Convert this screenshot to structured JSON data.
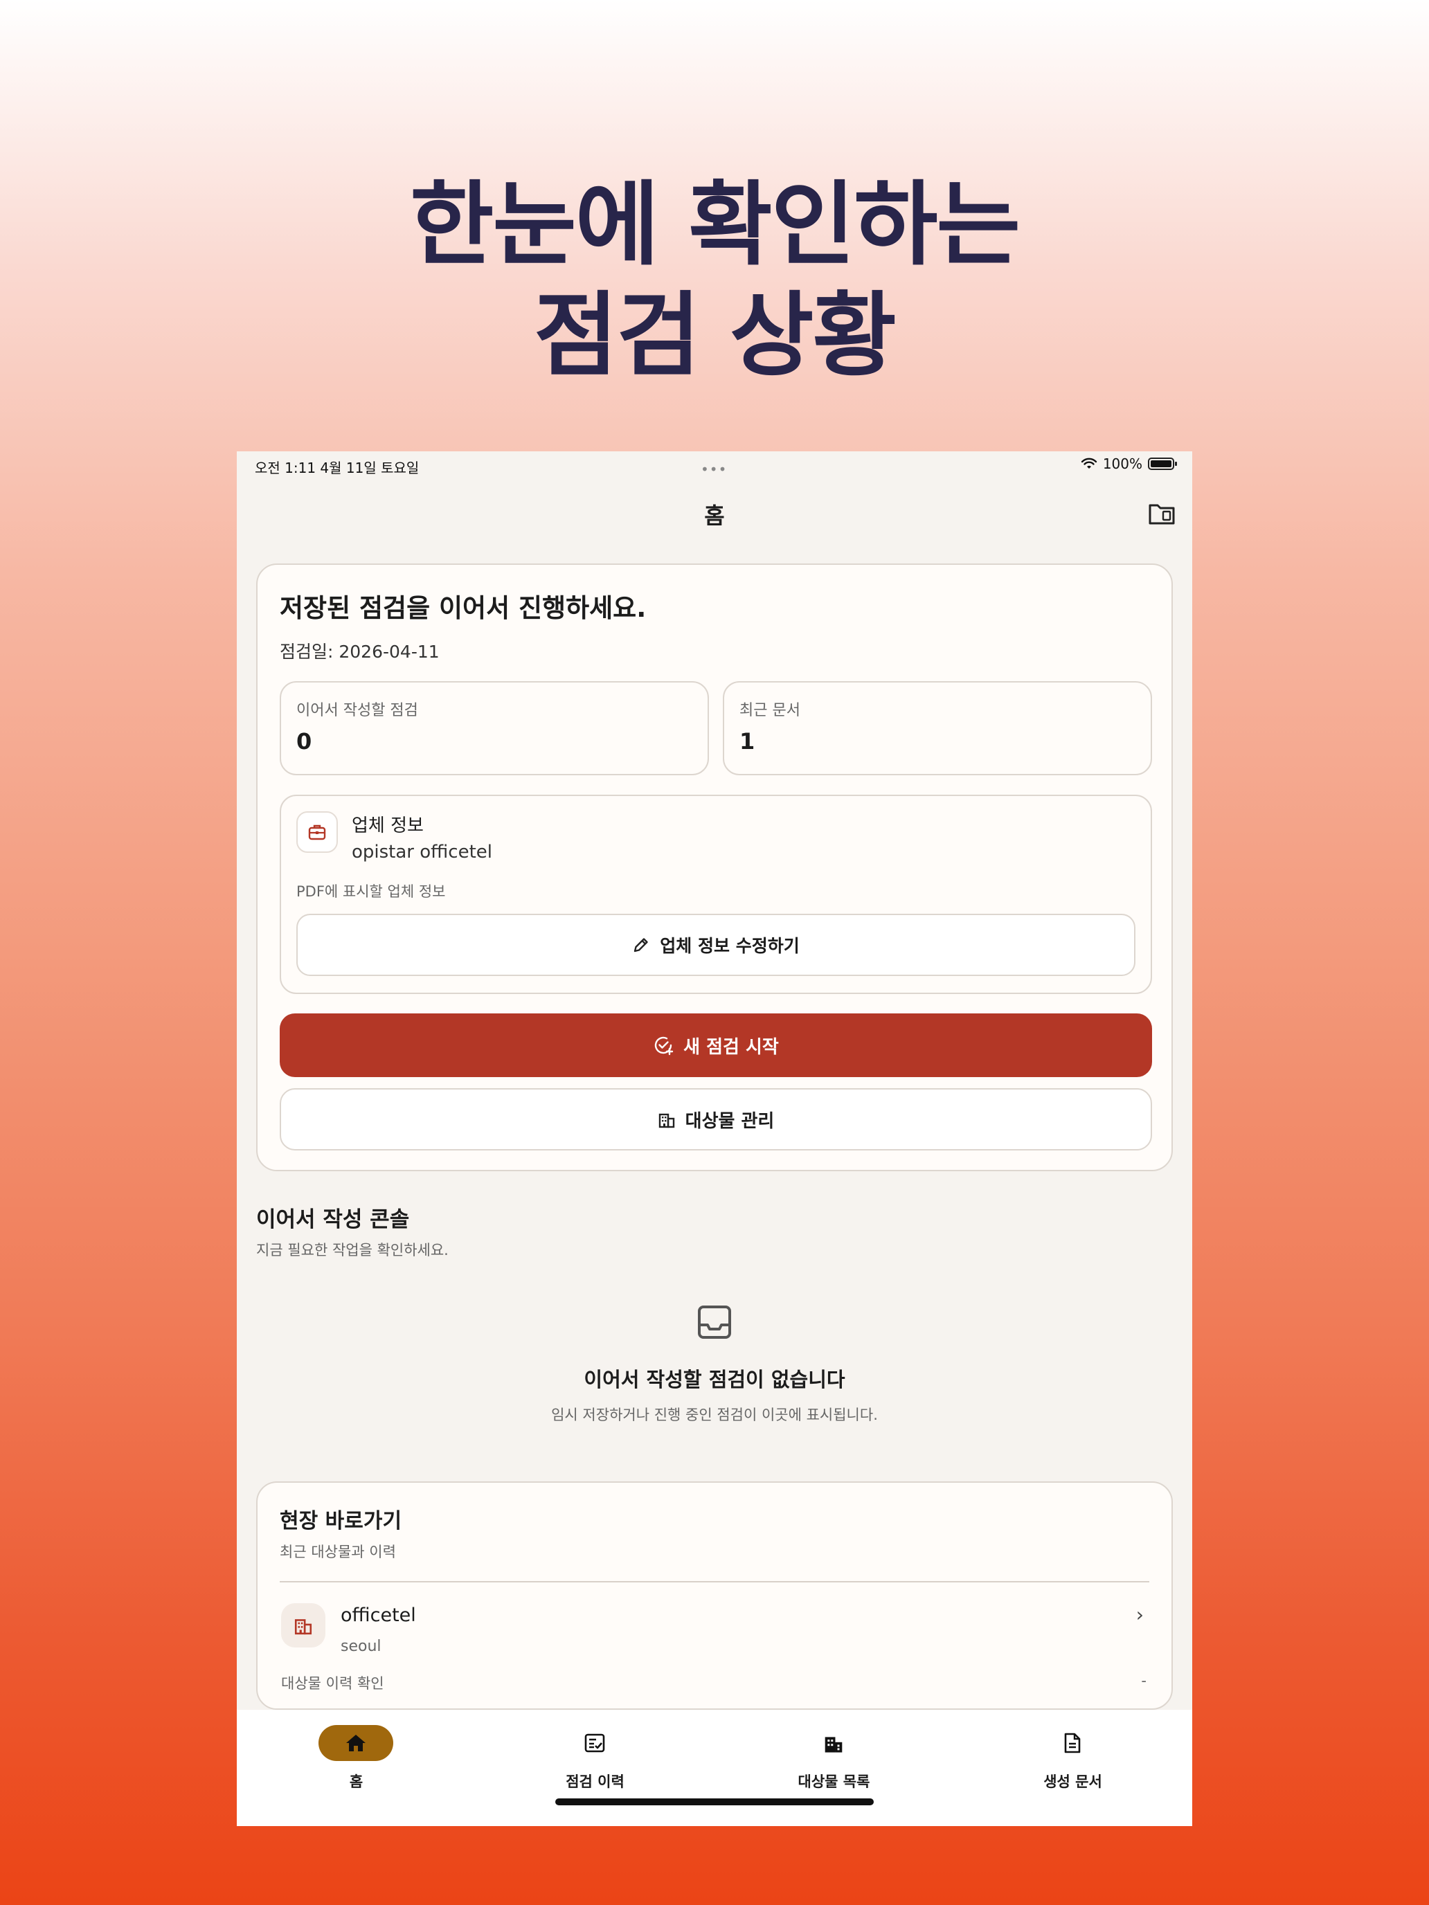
{
  "promo": {
    "headline_line1": "한눈에 확인하는",
    "headline_line2": "점검 상황"
  },
  "status_bar": {
    "time_date": "오전 1:11   4월 11일 토요일",
    "dots": "•••",
    "battery": "100%"
  },
  "nav": {
    "title": "홈"
  },
  "main_card": {
    "title": "저장된 점검을 이어서 진행하세요.",
    "date": "점검일: 2026-04-11",
    "stats": [
      {
        "label": "이어서 작성할 점검",
        "value": "0"
      },
      {
        "label": "최근 문서",
        "value": "1"
      }
    ],
    "company": {
      "label": "업체 정보",
      "name": "opistar officetel",
      "note": "PDF에 표시할 업체 정보",
      "edit_button": "업체 정보 수정하기"
    },
    "start_button": "새 점검 시작",
    "manage_button": "대상물 관리"
  },
  "console": {
    "title": "이어서 작성 콘솔",
    "subtitle": "지금 필요한 작업을 확인하세요.",
    "empty_title": "이어서 작성할 점검이 없습니다",
    "empty_subtitle": "임시 저장하거나 진행 중인 점검이 이곳에 표시됩니다."
  },
  "shortcuts": {
    "title": "현장 바로가기",
    "subtitle": "최근 대상물과 이력",
    "items": [
      {
        "name": "officetel",
        "location": "seoul",
        "history": "대상물 이력 확인",
        "value": "-"
      }
    ]
  },
  "tabs": [
    {
      "label": "홈",
      "icon": "home-icon",
      "active": true
    },
    {
      "label": "점검 이력",
      "icon": "checklist-icon",
      "active": false
    },
    {
      "label": "대상물 목록",
      "icon": "building-icon",
      "active": false
    },
    {
      "label": "생성 문서",
      "icon": "document-icon",
      "active": false
    }
  ],
  "colors": {
    "primary": "#b33726",
    "tab_active": "#a0680d",
    "headline": "#28254a"
  }
}
